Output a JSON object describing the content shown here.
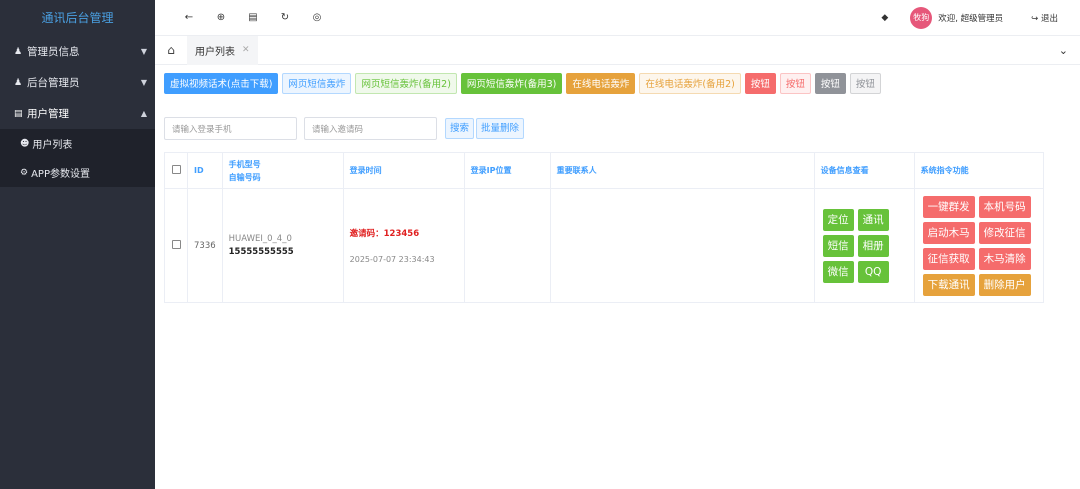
{
  "sidebar": {
    "brand": "通讯后台管理",
    "groups": [
      {
        "label": "管理员信息",
        "icon": "user-icon"
      },
      {
        "label": "后台管理员",
        "icon": "user-icon"
      },
      {
        "label": "用户管理",
        "icon": "id-card-icon"
      }
    ],
    "sub_items": [
      {
        "label": "用户列表",
        "icon": "user-outline-icon"
      },
      {
        "label": "APP参数设置",
        "icon": "gear-icon"
      }
    ]
  },
  "topbar": {
    "icons": [
      "back-icon",
      "crosshair-icon",
      "bank-icon",
      "refresh-icon",
      "globe-icon"
    ],
    "avatar_text": "牧狗",
    "welcome": "欢迎, 超级管理员",
    "logout": "退出"
  },
  "tabbar": {
    "tab_label": "用户列表"
  },
  "action_buttons": [
    {
      "label": "虚拟视频话术(点击下载)",
      "style": "b-blue"
    },
    {
      "label": "网页短信轰炸",
      "style": "b-blue-plain"
    },
    {
      "label": "网页短信轰炸(备用2)",
      "style": "b-green-plain"
    },
    {
      "label": "网页短信轰炸(备用3)",
      "style": "b-green"
    },
    {
      "label": "在线电话轰炸",
      "style": "b-orange"
    },
    {
      "label": "在线电话轰炸(备用2)",
      "style": "b-orange-plain"
    },
    {
      "label": "按钮",
      "style": "b-red"
    },
    {
      "label": "按钮",
      "style": "b-red-plain"
    },
    {
      "label": "按钮",
      "style": "b-gray"
    },
    {
      "label": "按钮",
      "style": "b-gray-plain"
    }
  ],
  "search": {
    "phone_placeholder": "请输入登录手机",
    "invite_placeholder": "请输入邀请码",
    "search_label": "搜索",
    "batch_delete_label": "批量删除"
  },
  "table": {
    "headers": {
      "id": "ID",
      "model_line1": "手机型号",
      "model_line2": "自输号码",
      "login_time": "登录时间",
      "login_ip": "登录IP位置",
      "contacts": "重要联系人",
      "device": "设备信息查看",
      "commands": "系统指令功能"
    },
    "row": {
      "id": "7336",
      "model": "HUAWEI_0_4_0",
      "phone": "15555555555",
      "invite": "邀请码：123456",
      "time": "2025-07-07 23:34:43",
      "ip": "",
      "contacts": ""
    },
    "device_buttons": [
      "定位",
      "通讯",
      "短信",
      "相册",
      "微信",
      "QQ"
    ],
    "command_buttons": [
      {
        "label": "一键群发",
        "style": "sr"
      },
      {
        "label": "本机号码",
        "style": "sr"
      },
      {
        "label": "启动木马",
        "style": "sr"
      },
      {
        "label": "修改征信",
        "style": "sr"
      },
      {
        "label": "征信获取",
        "style": "sr"
      },
      {
        "label": "木马清除",
        "style": "sr"
      },
      {
        "label": "下载通讯",
        "style": "so"
      },
      {
        "label": "删除用户",
        "style": "so"
      }
    ]
  }
}
